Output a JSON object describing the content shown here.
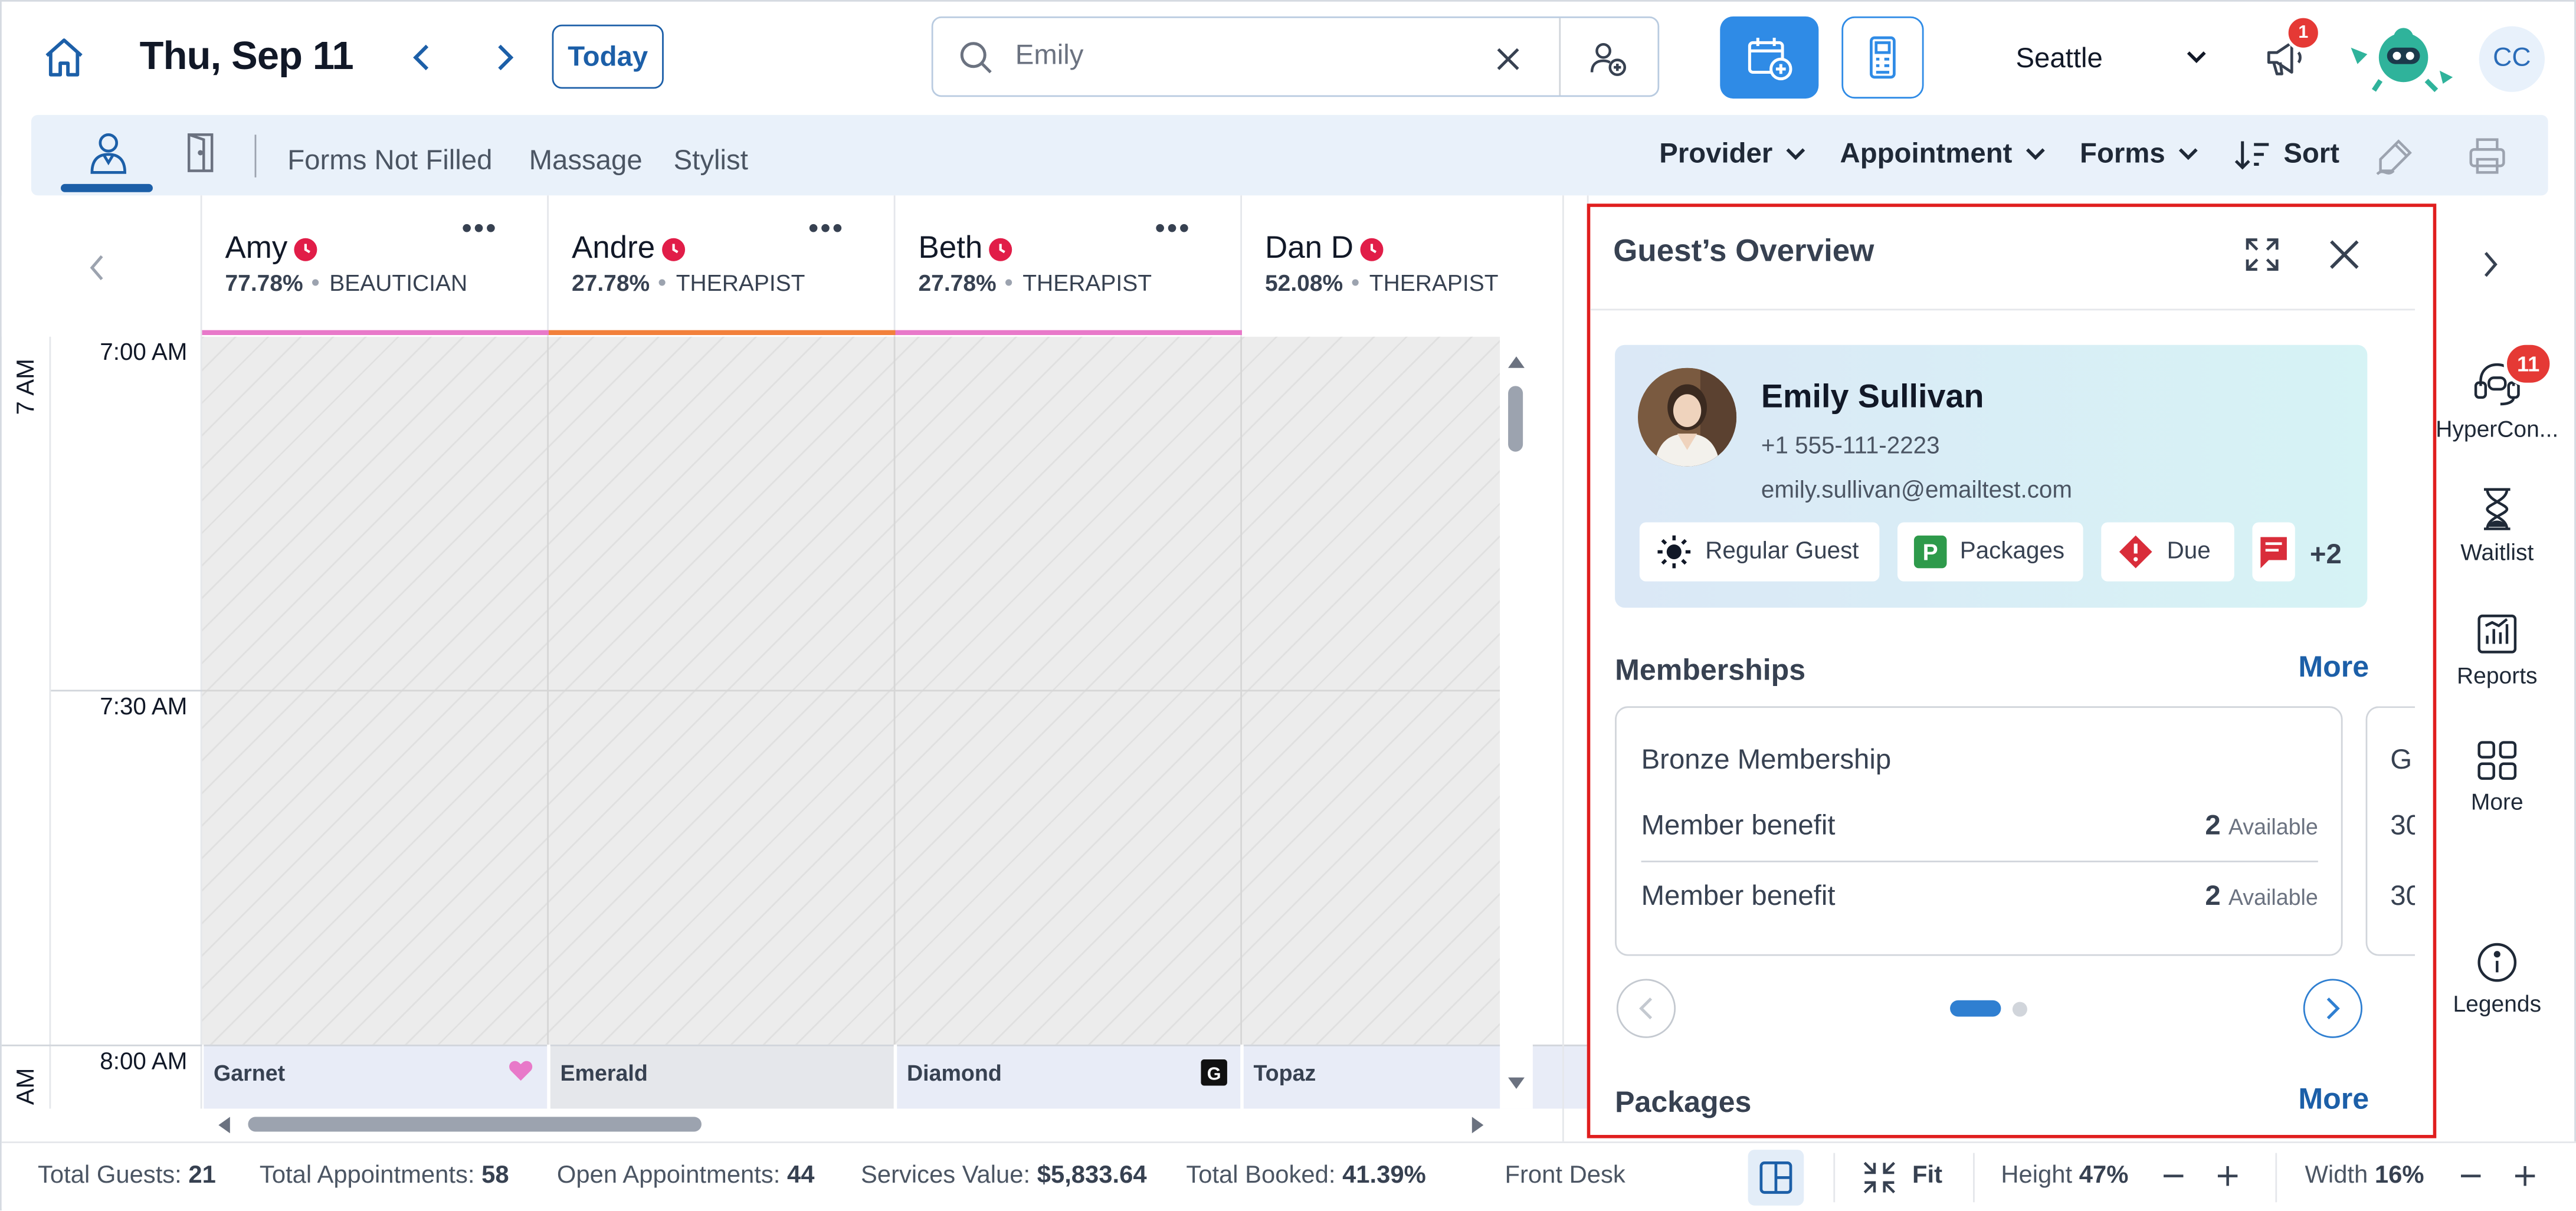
{
  "header": {
    "date": "Thu, Sep 11",
    "today_label": "Today",
    "search_value": "Emily",
    "location": "Seattle",
    "notification_count": "1",
    "avatar_initials": "CC"
  },
  "filters": {
    "tabs": [
      "Forms Not Filled",
      "Massage",
      "Stylist"
    ],
    "dropdowns": [
      "Provider",
      "Appointment",
      "Forms"
    ],
    "sort_label": "Sort"
  },
  "providers": [
    {
      "name": "Amy",
      "percent": "77.78%",
      "role": "BEAUTICIAN",
      "color": "#e879c9"
    },
    {
      "name": "Andre",
      "percent": "27.78%",
      "role": "THERAPIST",
      "color": "#f2803b"
    },
    {
      "name": "Beth",
      "percent": "27.78%",
      "role": "THERAPIST",
      "color": "#e879c9"
    },
    {
      "name": "Dan D",
      "percent": "52.08%",
      "role": "THERAPIST",
      "color": "#ffffff"
    }
  ],
  "schedule": {
    "hour_labels": [
      "7 AM",
      "AM"
    ],
    "time_labels": [
      "7:00 AM",
      "7:30 AM",
      "8:00 AM"
    ],
    "appointments": [
      "Garnet",
      "Emerald",
      "Diamond",
      "Topaz"
    ]
  },
  "overview": {
    "title": "Guest’s Overview",
    "guest": {
      "name": "Emily Sullivan",
      "phone": "+1 555-111-2223",
      "email": "emily.sullivan@emailtest.com"
    },
    "chips": [
      {
        "label": "Regular Guest",
        "icon": "sun-icon"
      },
      {
        "label": "Packages",
        "icon": "packages-p-icon"
      },
      {
        "label": "Due",
        "icon": "due-alert-icon"
      }
    ],
    "chips_more": "+2",
    "memberships": {
      "title": "Memberships",
      "more": "More",
      "card_title": "Bronze Membership",
      "rows": [
        {
          "label": "Member benefit",
          "count": "2",
          "status": "Available"
        },
        {
          "label": "Member benefit",
          "count": "2",
          "status": "Available"
        }
      ],
      "peek_title": "G",
      "peek_rows": [
        "30",
        "30"
      ]
    },
    "packages": {
      "title": "Packages",
      "more": "More"
    }
  },
  "rail": {
    "hyperconnect_label": "HyperCon...",
    "hyperconnect_badge": "11",
    "waitlist_label": "Waitlist",
    "reports_label": "Reports",
    "more_label": "More",
    "legends_label": "Legends"
  },
  "footer": {
    "total_guests_label": "Total Guests:",
    "total_guests": "21",
    "total_appts_label": "Total Appointments:",
    "total_appts": "58",
    "open_appts_label": "Open Appointments:",
    "open_appts": "44",
    "services_value_label": "Services Value:",
    "services_value": "$5,833.64",
    "total_booked_label": "Total Booked:",
    "total_booked": "41.39%",
    "front_desk": "Front Desk",
    "fit_label": "Fit",
    "height_label": "Height",
    "height_value": "47%",
    "width_label": "Width",
    "width_value": "16%"
  }
}
